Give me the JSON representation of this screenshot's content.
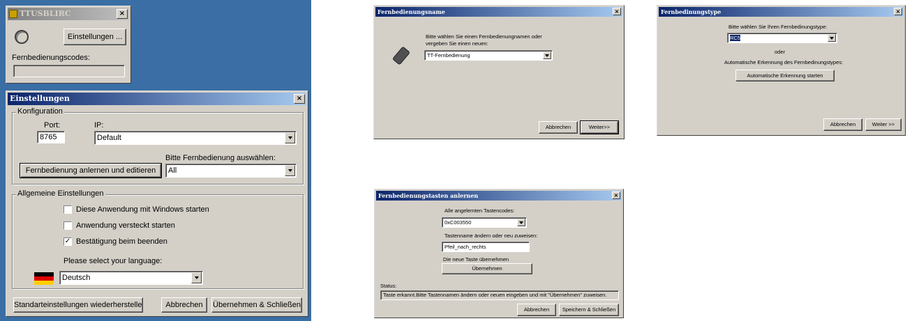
{
  "ttusblirc": {
    "title": "TTUSBLIRC",
    "settings_button": "Einstellungen ...",
    "codes_label": "Fernbedienungscodes:",
    "codes_value": ""
  },
  "einstellungen": {
    "title": "Einstellungen",
    "konfiguration": {
      "legend": "Konfiguration",
      "port_label": "Port:",
      "port_value": "8765",
      "ip_label": "IP:",
      "ip_value": "Default",
      "remote_select_label": "Bitte Fernbedienung auswählen:",
      "remote_select_value": "All",
      "learn_button": "Fernbedienung anlernen und editieren"
    },
    "allgemein": {
      "legend": "Allgemeine Einstellungen",
      "options": [
        {
          "label": "Diese Anwendung mit Windows starten",
          "checked": false
        },
        {
          "label": "Anwendung versteckt starten",
          "checked": false
        },
        {
          "label": "Bestätigung beim beenden",
          "checked": true
        }
      ],
      "language_label": "Please select your language:",
      "language_value": "Deutsch"
    },
    "buttons": {
      "reset": "Standarteinstellungen wiederherstellen",
      "cancel": "Abbrechen",
      "apply": "Übernehmen & Schließen"
    }
  },
  "fernbedienungsname": {
    "title": "Fernbedienungsname",
    "prompt_line1": "Bitte wählen Sie einen Fernbedienungnamen oder",
    "prompt_line2": "vergeben Sie einen neuen:",
    "name_value": "TT-Fernbedienung",
    "cancel": "Abbrechen",
    "next": "Weiter>>"
  },
  "fernbedienungstype": {
    "title": "Fernbedinungstype",
    "prompt": "Bitte wählen Sie Ihren Fernbedinungstype:",
    "type_value": "RC5",
    "oder": "oder",
    "auto_label": "Automatische Erkennung des Fernbedinungstypes:",
    "auto_button": "Automatische Erkennung starten",
    "cancel": "Abbrechen",
    "next": "Weiter >>"
  },
  "tasten": {
    "title": "Fernbedienungstasten anlernen",
    "codes_label": "Alle angelernten Tastencodes:",
    "codes_value": "0xC003550",
    "name_label": "Tastenname ändern oder neu zuweisen:",
    "name_value": "Pfeil_nach_rechts",
    "apply_label": "Die neue Taste übernehmen",
    "apply_button": "Übernehmen",
    "status_label": "Status:",
    "status_value": "Taste erkannt.Bitte Tastennamen ändern oder neuen eingeben und mit \"Übernehmen\" zuweisen.",
    "cancel": "Abbrechen",
    "save": "Speichern & Schließen"
  },
  "colors": {
    "window_bg": "#d4d0c8",
    "titlebar_active": "#0a246a",
    "desktop_bg": "#3a6ea5"
  }
}
